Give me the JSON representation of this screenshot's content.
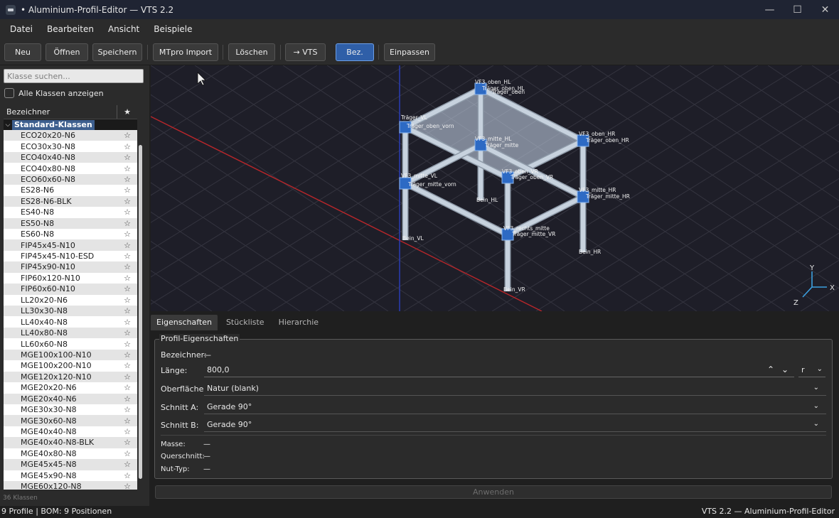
{
  "window": {
    "title": "• Aluminium-Profil-Editor — VTS 2.2",
    "controls": {
      "minimize": "—",
      "maximize": "☐",
      "close": "✕"
    }
  },
  "menu": [
    "Datei",
    "Bearbeiten",
    "Ansicht",
    "Beispiele"
  ],
  "toolbar": {
    "new": "Neu",
    "open": "Öffnen",
    "save": "Speichern",
    "import": "MTpro Import",
    "delete": "Löschen",
    "to_vts": "→ VTS",
    "labels": "Bez.",
    "fit": "Einpassen",
    "labels_active": true
  },
  "left": {
    "search_placeholder": "Klasse suchen...",
    "show_all_label": "Alle Klassen anzeigen",
    "col_name": "Bezeichner",
    "col_star": "★",
    "group_toggle": "⌵",
    "group_label": "Standard-Klassen",
    "star_glyph": "☆",
    "items": [
      "ECO20x20-N6",
      "ECO30x30-N8",
      "ECO40x40-N8",
      "ECO40x80-N8",
      "ECO60x60-N8",
      "ES28-N6",
      "ES28-N6-BLK",
      "ES40-N8",
      "ES50-N8",
      "ES60-N8",
      "FIP45x45-N10",
      "FIP45x45-N10-ESD",
      "FIP45x90-N10",
      "FIP60x120-N10",
      "FIP60x60-N10",
      "LL20x20-N6",
      "LL30x30-N8",
      "LL40x40-N8",
      "LL40x80-N8",
      "LL60x60-N8",
      "MGE100x100-N10",
      "MGE100x200-N10",
      "MGE120x120-N10",
      "MGE20x20-N6",
      "MGE20x40-N6",
      "MGE30x30-N8",
      "MGE30x60-N8",
      "MGE40x40-N8",
      "MGE40x40-N8-BLK",
      "MGE40x80-N8",
      "MGE45x45-N8",
      "MGE45x90-N8",
      "MGE60x120-N8"
    ],
    "count": "36 Klassen"
  },
  "viewport": {
    "labels": [
      "VF3_oben_HL",
      "Träger_oben_HL",
      "Träger_oben",
      "Träger_VL",
      "Träger_oben_vorn",
      "VF3_mitte_HL",
      "Träger_mitte",
      "VF3_oben_HR",
      "Träger_oben_HR",
      "VF3_mitte_VL",
      "Träger_mitte_vorn",
      "VF3_oben_VR",
      "Träger_oben_VR",
      "Bein_HL",
      "VF3_mitte_HR",
      "Träger_mitte_HR",
      "VF3_rechts_mitte",
      "Träger_mitte_VR",
      "Bein_VL",
      "Bein_HR",
      "Bein_VR"
    ],
    "axes": {
      "x": "X",
      "y": "Y",
      "z": "Z"
    },
    "colors": {
      "profile": "#c7d2de",
      "cube": "#2d6ac4",
      "x_axis": "#c02020",
      "y_axis": "#2a3fb0",
      "grid": "#34343f"
    }
  },
  "tabs": [
    "Eigenschaften",
    "Stückliste",
    "Hierarchie"
  ],
  "props": {
    "group": "Profil-Eigenschaften",
    "name_label": "Bezeichner:",
    "name_value": "—",
    "length_label": "Länge:",
    "length_value": "800,0",
    "length_unit": "r",
    "stepper_up": "⌃",
    "stepper_down": "⌄",
    "chevron": "⌄",
    "surface_label": "Oberfläche:",
    "surface_value": "Natur (blank)",
    "cut_a_label": "Schnitt A:",
    "cut_a_value": "Gerade 90°",
    "cut_b_label": "Schnitt B:",
    "cut_b_value": "Gerade 90°",
    "mass_label": "Masse:",
    "mass_value": "—",
    "section_label": "Querschnitt:",
    "section_value": "—",
    "slot_label": "Nut-Typ:",
    "slot_value": "—",
    "apply": "Anwenden"
  },
  "status": {
    "left": "9 Profile  |  BOM: 9 Positionen",
    "right": "VTS 2.2 — Aluminium-Profil-Editor"
  }
}
